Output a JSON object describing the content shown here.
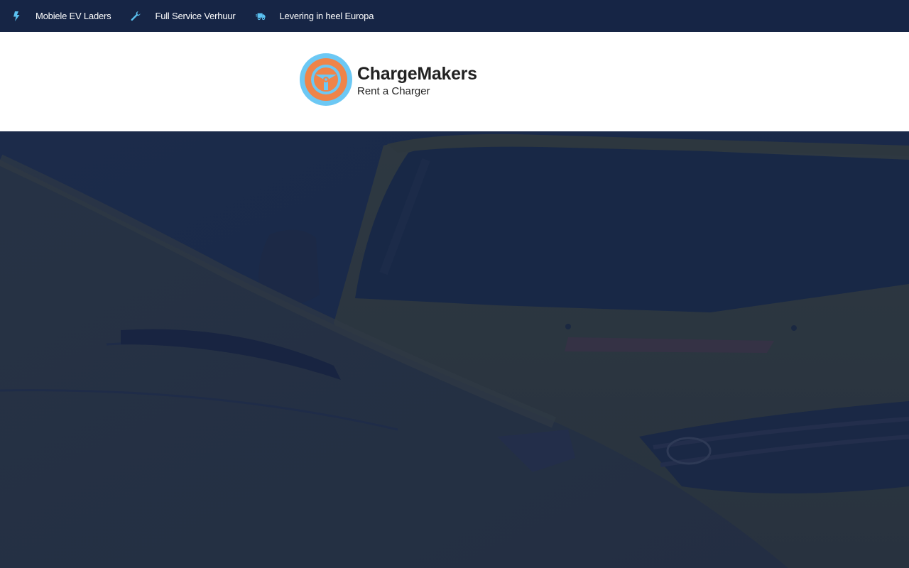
{
  "topbar": {
    "items": [
      {
        "icon": "bolt-icon",
        "label": "Mobiele EV Laders"
      },
      {
        "icon": "wrench-icon",
        "label": "Full Service Verhuur"
      },
      {
        "icon": "delivery-truck-icon",
        "label": "Levering in heel Europa"
      }
    ]
  },
  "header": {
    "logo": {
      "icon": "charger-wheel-logo",
      "name": "ChargeMakers",
      "tagline": "Rent a Charger"
    }
  },
  "colors": {
    "topbar_bg": "#162545",
    "icon_accent": "#5bc2f1",
    "logo_ring": "#6cc8f4",
    "logo_orange": "#ef8449",
    "hero_overlay": "#162545"
  },
  "hero": {
    "image": "hero-van-photo"
  }
}
